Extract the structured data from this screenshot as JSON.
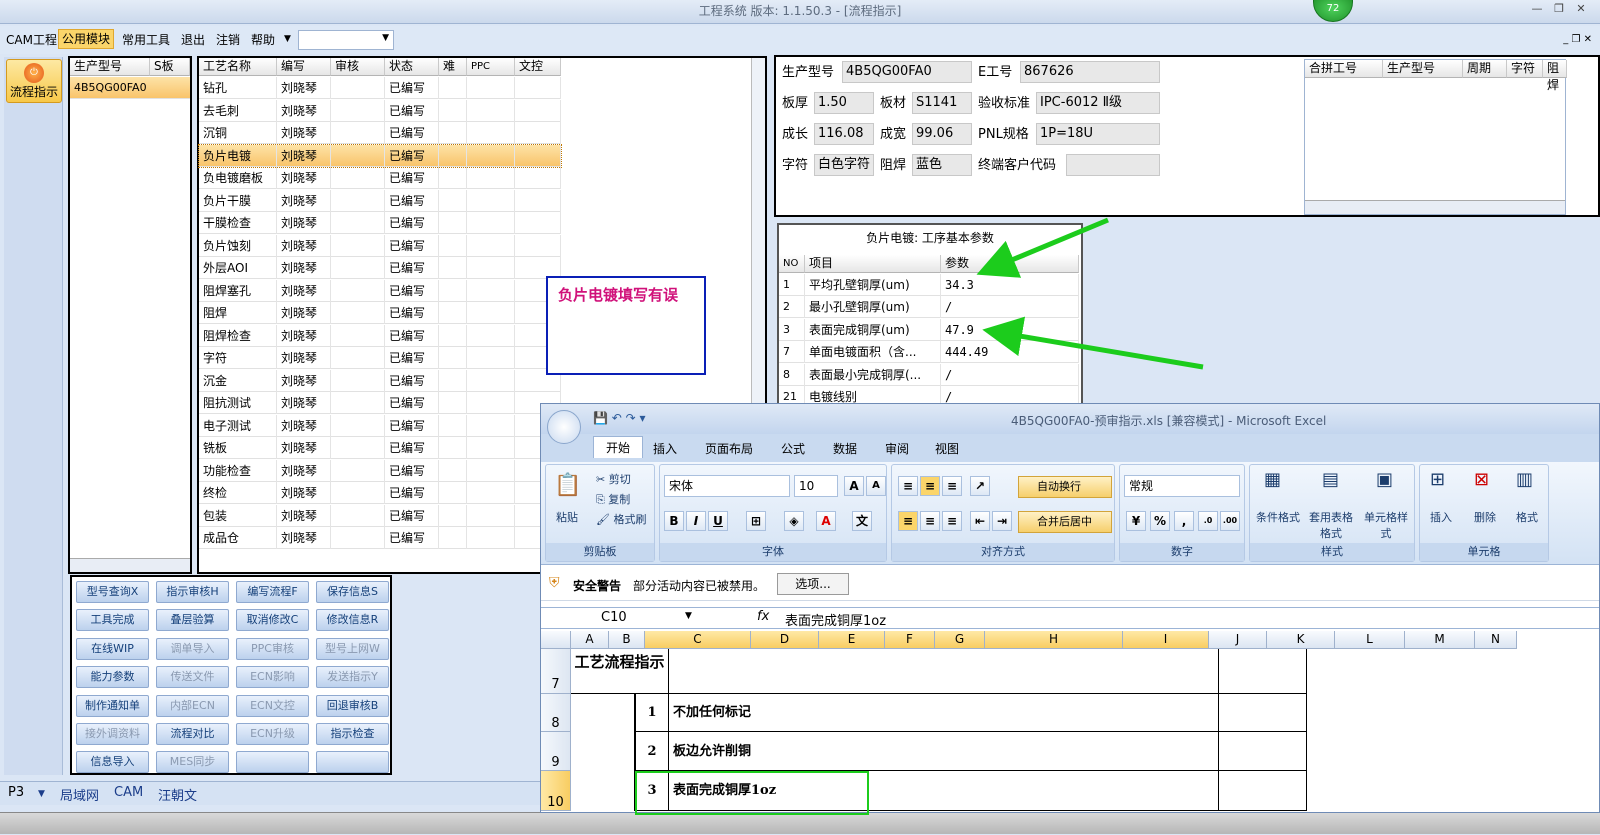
{
  "window": {
    "title": "工程系统   版本: 1.1.50.3 - [流程指示]",
    "badge": "72"
  },
  "menu": [
    {
      "label": "CAM工程"
    },
    {
      "label": "公用模块"
    },
    {
      "label": "常用工具"
    },
    {
      "label": "退出"
    },
    {
      "label": "注销"
    },
    {
      "label": "帮助"
    }
  ],
  "left_nav": {
    "flow_button": "流程指示"
  },
  "model_grid": {
    "headers": [
      "生产型号",
      "S板"
    ],
    "rows": [
      "4B5QG00FA0"
    ]
  },
  "process_grid": {
    "headers": [
      "工艺名称",
      "编写",
      "审核",
      "状态",
      "难",
      "PPC",
      "文控"
    ],
    "rows": [
      [
        "钻孔",
        "刘晓琴",
        "",
        "已编写"
      ],
      [
        "去毛刺",
        "刘晓琴",
        "",
        "已编写"
      ],
      [
        "沉铜",
        "刘晓琴",
        "",
        "已编写"
      ],
      [
        "负片电镀",
        "刘晓琴",
        "",
        "已编写"
      ],
      [
        "负电镀磨板",
        "刘晓琴",
        "",
        "已编写"
      ],
      [
        "负片干膜",
        "刘晓琴",
        "",
        "已编写"
      ],
      [
        "干膜检查",
        "刘晓琴",
        "",
        "已编写"
      ],
      [
        "负片蚀刻",
        "刘晓琴",
        "",
        "已编写"
      ],
      [
        "外层AOI",
        "刘晓琴",
        "",
        "已编写"
      ],
      [
        "阻焊塞孔",
        "刘晓琴",
        "",
        "已编写"
      ],
      [
        "阻焊",
        "刘晓琴",
        "",
        "已编写"
      ],
      [
        "阻焊检查",
        "刘晓琴",
        "",
        "已编写"
      ],
      [
        "字符",
        "刘晓琴",
        "",
        "已编写"
      ],
      [
        "沉金",
        "刘晓琴",
        "",
        "已编写"
      ],
      [
        "阻抗测试",
        "刘晓琴",
        "",
        "已编写"
      ],
      [
        "电子测试",
        "刘晓琴",
        "",
        "已编写"
      ],
      [
        "铣板",
        "刘晓琴",
        "",
        "已编写"
      ],
      [
        "功能检查",
        "刘晓琴",
        "",
        "已编写"
      ],
      [
        "终检",
        "刘晓琴",
        "",
        "已编写"
      ],
      [
        "包装",
        "刘晓琴",
        "",
        "已编写"
      ],
      [
        "成品仓",
        "刘晓琴",
        "",
        "已编写"
      ]
    ]
  },
  "func_buttons": [
    [
      "型号查询X",
      "指示审核H",
      "编写流程F",
      "保存信息S"
    ],
    [
      "工具完成",
      "叠层验算",
      "取消修改C",
      "修改信息R"
    ],
    [
      "在线WIP",
      "调单导入",
      "PPC审核",
      "型号上网W"
    ],
    [
      "能力参数",
      "传送文件",
      "ECN影响",
      "发送指示Y"
    ],
    [
      "制作通知单",
      "内部ECN",
      "ECN文控",
      "回退审核B"
    ],
    [
      "接外调资料",
      "流程对比",
      "ECN升级",
      "指示检查"
    ],
    [
      "信息导入",
      "MES同步",
      "",
      ""
    ]
  ],
  "status_bar": [
    "P3",
    "局域网",
    "CAM",
    "汪朝文"
  ],
  "note": "负片电镀填写有误",
  "info": {
    "model_label": "生产型号",
    "model": "4B5QG00FA0",
    "e_label": "E工号",
    "e_no": "867626",
    "thick_label": "板厚",
    "thick": "1.50",
    "mat_label": "板材",
    "mat": "S1141",
    "std_label": "验收标准",
    "std": "IPC-6012 Ⅱ级",
    "len_label": "成长",
    "len": "116.08",
    "wid_label": "成宽",
    "wid": "99.06",
    "pnl_label": "PNL规格",
    "pnl": "1P=18U",
    "char_label": "字符",
    "char": "白色字符",
    "mask_label": "阻焊",
    "mask": "蓝色",
    "cust_label": "终端客户代码",
    "cust": ""
  },
  "merge_grid": {
    "headers": [
      "合拼工号",
      "生产型号",
      "周期",
      "字符",
      "阻焊"
    ]
  },
  "params": {
    "title": "负片电镀: 工序基本参数",
    "headers": [
      "NO",
      "项目",
      "参数"
    ],
    "rows": [
      [
        "1",
        "平均孔壁铜厚(um)",
        "34.3"
      ],
      [
        "2",
        "最小孔壁铜厚(um)",
        "/"
      ],
      [
        "3",
        "表面完成铜厚(um)",
        "47.9"
      ],
      [
        "7",
        "单面电镀面积（含...",
        "444.49"
      ],
      [
        "8",
        "表面最小完成铜厚(...",
        "/"
      ],
      [
        "21",
        "电镀线别",
        "/"
      ]
    ]
  },
  "excel": {
    "title": "4B5QG00FA0-预审指示.xls  [兼容模式] - Microsoft Excel",
    "tabs": [
      "开始",
      "插入",
      "页面布局",
      "公式",
      "数据",
      "审阅",
      "视图"
    ],
    "clipboard": {
      "paste": "粘贴",
      "cut": "剪切",
      "copy": "复制",
      "painter": "格式刷",
      "label": "剪贴板"
    },
    "font": {
      "name": "宋体",
      "size": "10",
      "label": "字体"
    },
    "align": {
      "wrap": "自动换行",
      "merge": "合并后居中",
      "label": "对齐方式"
    },
    "number": {
      "format": "常规",
      "label": "数字"
    },
    "styles": {
      "cond": "条件格式",
      "table": "套用表格格式",
      "cell": "单元格样式",
      "label": "样式"
    },
    "cells": {
      "insert": "插入",
      "delete": "删除",
      "format": "格式",
      "label": "单元格"
    },
    "security": {
      "label": "安全警告",
      "text": "部分活动内容已被禁用。",
      "options": "选项..."
    },
    "namebox": "C10",
    "formula": "表面完成铜厚1oz",
    "columns": [
      "A",
      "B",
      "C",
      "D",
      "E",
      "F",
      "G",
      "H",
      "I",
      "J",
      "K",
      "L",
      "M",
      "N"
    ],
    "rows": [
      {
        "num": "7",
        "a": "工艺流程指示",
        "b": "",
        "c": ""
      },
      {
        "num": "8",
        "a": "",
        "b": "1",
        "c": "不加任何标记"
      },
      {
        "num": "9",
        "a": "",
        "b": "2",
        "c": "板边允许削铜"
      },
      {
        "num": "10",
        "a": "",
        "b": "3",
        "c": "表面完成铜厚1oz"
      }
    ]
  },
  "colors": {
    "highlight": "#1ccc1c",
    "note_text": "#d0117a",
    "note_border": "#0a1fb6",
    "selected": "#f9c46b"
  }
}
